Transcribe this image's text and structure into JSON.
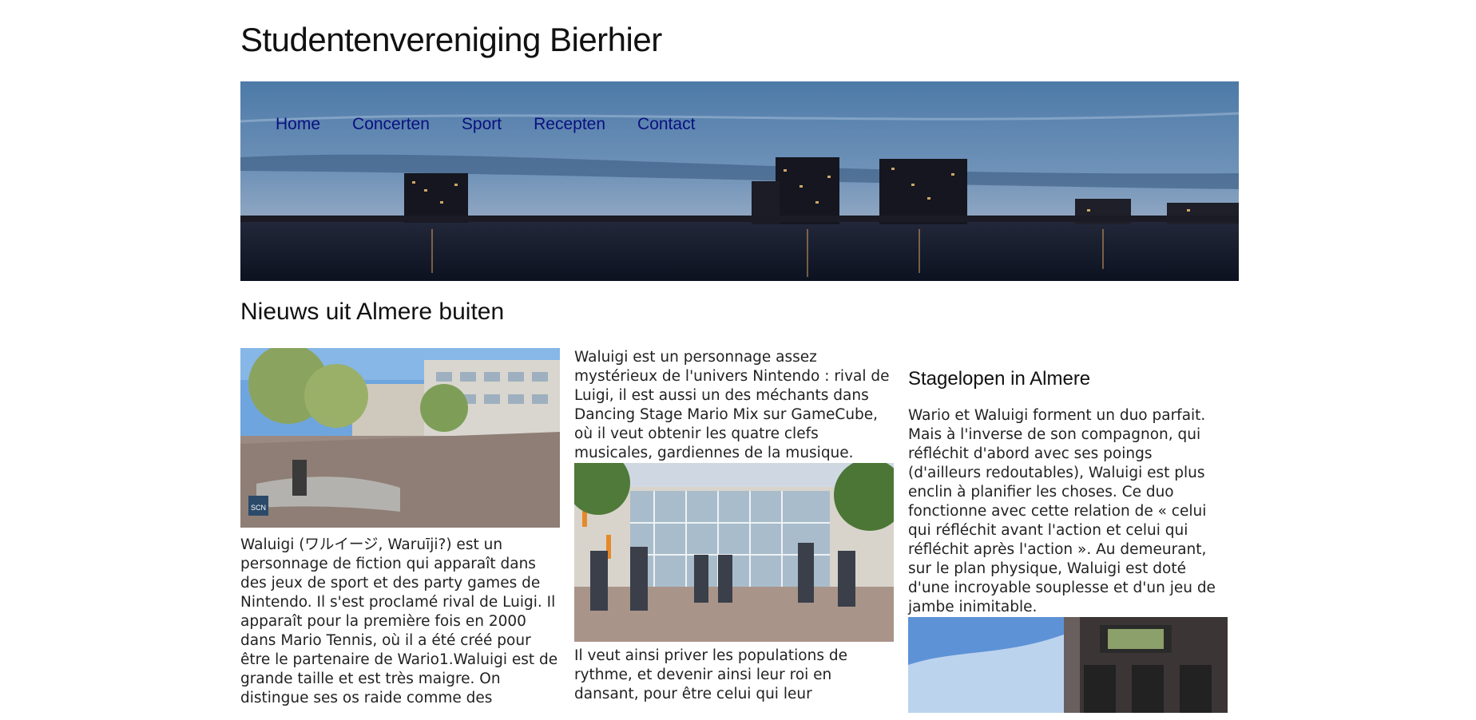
{
  "site": {
    "title": "Studentenvereniging Bierhier"
  },
  "nav": {
    "items": [
      {
        "label": "Home"
      },
      {
        "label": "Concerten"
      },
      {
        "label": "Sport"
      },
      {
        "label": "Recepten"
      },
      {
        "label": "Contact"
      }
    ],
    "link_color": "#0a1080"
  },
  "main": {
    "heading": "Nieuws uit Almere buiten",
    "col1": {
      "image_badge": "SCN",
      "text": "Waluigi (ワルイージ, Waruīji?) est un personnage de fiction qui apparaît dans des jeux de sport et des party games de Nintendo. Il s'est proclamé rival de Luigi. Il apparaît pour la première fois en 2000 dans Mario Tennis, où il a été créé pour être le partenaire de Wario1.Waluigi est de grande taille et est très maigre. On distingue ses os raide comme des"
    },
    "col2": {
      "text_top": "Waluigi est un personnage assez mystérieux de l'univers Nintendo : rival de Luigi, il est aussi un des méchants dans Dancing Stage Mario Mix sur GameCube, où il veut obtenir les quatre clefs musicales, gardiennes de la musique.",
      "text_bottom": "Il veut ainsi priver les populations de rythme, et devenir ainsi leur roi en dansant, pour être celui qui leur"
    },
    "col3": {
      "heading": "Stagelopen in Almere",
      "text": "Wario et Waluigi forment un duo parfait. Mais à l'inverse de son compagnon, qui réfléchit d'abord avec ses poings (d'ailleurs redoutables), Waluigi est plus enclin à planifier les choses. Ce duo fonctionne avec cette relation de « celui qui réfléchit avant l'action et celui qui réfléchit après l'action ». Au demeurant, sur le plan physique, Waluigi est doté d'une incroyable souplesse et d'un jeu de jambe inimitable."
    }
  }
}
